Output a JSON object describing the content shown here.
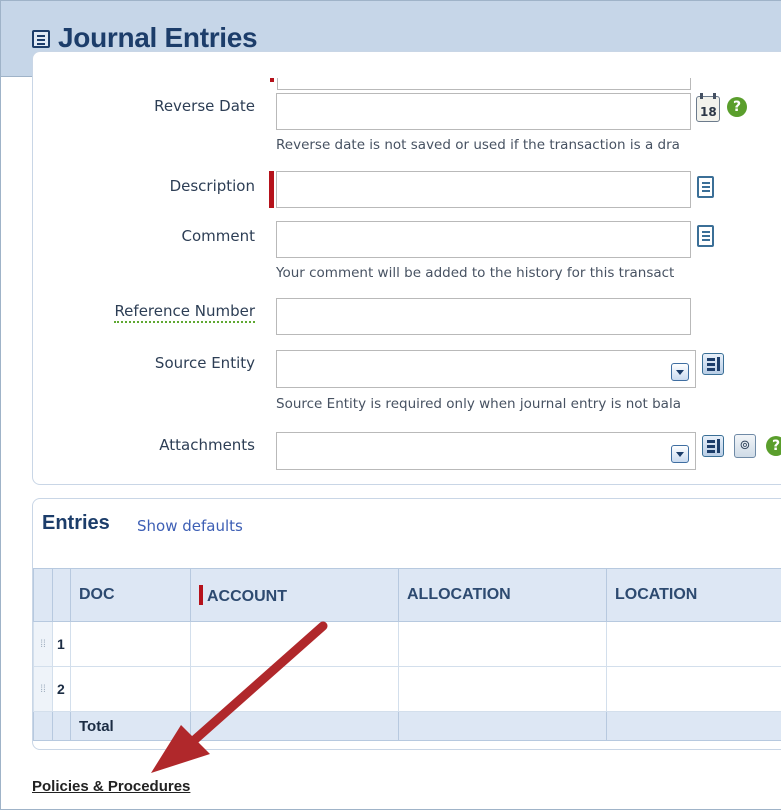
{
  "header": {
    "title": "Journal Entries",
    "icon": "list-icon"
  },
  "form": {
    "reverse_date": {
      "label": "Reverse Date",
      "value": "",
      "help_text": "Reverse date is not saved or used if the transaction is a dra"
    },
    "description": {
      "label": "Description",
      "value": ""
    },
    "comment": {
      "label": "Comment",
      "value": "",
      "help_text": "Your comment will be added to the history for this transact"
    },
    "reference_number": {
      "label": "Reference Number",
      "value": ""
    },
    "source_entity": {
      "label": "Source Entity",
      "value": "",
      "help_text": "Source Entity is required only when journal entry is not bala"
    },
    "attachments": {
      "label": "Attachments",
      "value": ""
    },
    "calendar_icon_text": "18",
    "help_icon_text": "?"
  },
  "entries": {
    "title": "Entries",
    "show_defaults": "Show defaults",
    "columns": [
      "DOC",
      "ACCOUNT",
      "ALLOCATION",
      "LOCATION"
    ],
    "rows": [
      {
        "num": "1",
        "doc": "",
        "account": "",
        "allocation": "",
        "location": ""
      },
      {
        "num": "2",
        "doc": "",
        "account": "",
        "allocation": "",
        "location": ""
      }
    ],
    "total_label": "Total"
  },
  "footer": {
    "policies_link": "Policies & Procedures"
  },
  "colors": {
    "accent": "#1c3d6a",
    "required": "#b5121b",
    "arrow": "#b0282b",
    "header_bg": "#c6d6e8"
  }
}
